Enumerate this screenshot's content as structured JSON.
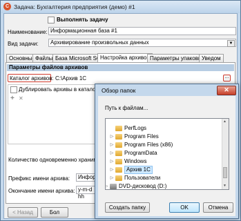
{
  "window": {
    "title": "Задача: Бухгалтерия предприятия (демо) #1",
    "minimize": "–",
    "maximize": "□",
    "close": "✕"
  },
  "form": {
    "execute_label": "Выполнять задачу",
    "name_label": "Наименование:",
    "name_value": "Информационная база #1",
    "type_label": "Вид задачи:",
    "type_value": "Архивирование произвольных данных"
  },
  "tabs": [
    "Основные",
    "Файлы",
    "База Microsoft SQL",
    "Настройка архивов",
    "Параметры упаковки",
    "Уведом"
  ],
  "archive": {
    "section_header": "Параметры файлов архивов",
    "catalog_label": "Каталог архивов:",
    "catalog_value": "C:\\Архив 1С",
    "browse_label": "...",
    "duplicate_label": "Дублировать архивы в каталоги -",
    "add_icon": "+",
    "remove_icon": "✕",
    "keep_count_label": "Количество одновременно хранимых ар",
    "prefix_label": "Префикс имени архива:",
    "prefix_value": "Информа",
    "suffix_label": "Окончание имени архива:",
    "suffix_value": "y-m-d hh"
  },
  "footer": {
    "back_label": "< Назад",
    "next_label": "Бол"
  },
  "dialog": {
    "title": "Обзор папок",
    "path_prompt": "Путь к файлам...",
    "tree": [
      {
        "label": "PerfLogs",
        "expandable": false
      },
      {
        "label": "Program Files",
        "expandable": true
      },
      {
        "label": "Program Files (x86)",
        "expandable": true
      },
      {
        "label": "ProgramData",
        "expandable": true
      },
      {
        "label": "Windows",
        "expandable": true
      },
      {
        "label": "Архив 1С",
        "expandable": true,
        "selected": true
      },
      {
        "label": "Пользователи",
        "expandable": true
      },
      {
        "label": "DVD-дисковод (D:)",
        "expandable": true
      }
    ],
    "create_folder_label": "Создать папку",
    "ok_label": "OK",
    "cancel_label": "Отмена"
  },
  "colors": {
    "accent_red": "#d0392b",
    "selection": "#cde8ff",
    "section_header": "#b7cde3"
  }
}
